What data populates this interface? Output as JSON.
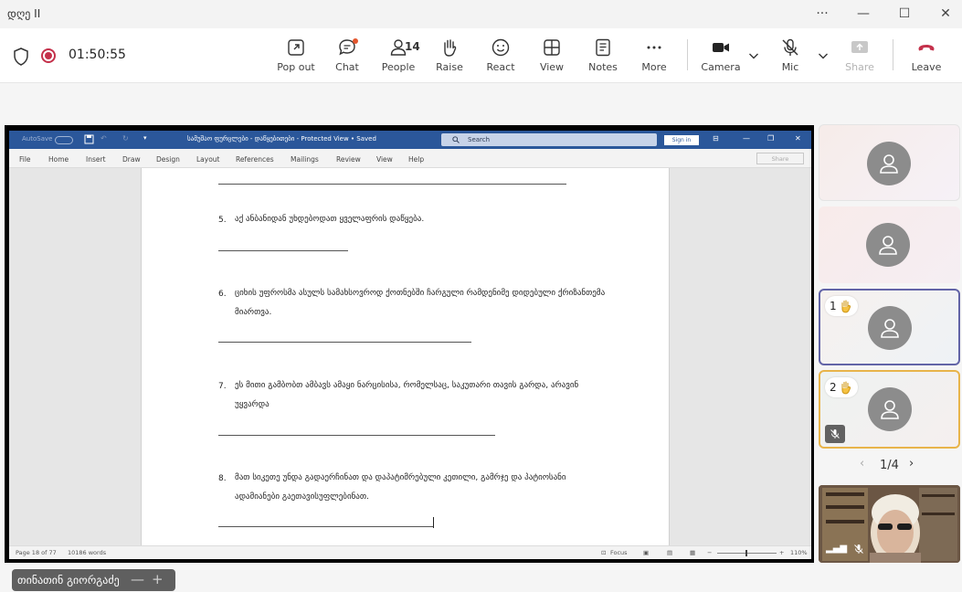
{
  "window": {
    "title": "დღე II",
    "controls": {
      "more": "···",
      "minimize": "—",
      "maximize": "☐",
      "close": "✕"
    }
  },
  "toolbar": {
    "timer": "01:50:55",
    "people_count": "14",
    "buttons": {
      "popout": "Pop out",
      "chat": "Chat",
      "people": "People",
      "raise": "Raise",
      "react": "React",
      "view": "View",
      "notes": "Notes",
      "more": "More",
      "camera": "Camera",
      "mic": "Mic",
      "share": "Share",
      "leave": "Leave"
    },
    "colors": {
      "leave": "#c4314b",
      "recording": "#c4314b",
      "chat_dot": "#e3562d"
    }
  },
  "word": {
    "autosave": "AutoSave",
    "doc_title": "სამუშაო ფურცლები - დაწყებითები  -  Protected View • Saved",
    "search_placeholder": "Search",
    "signin": "Sign in",
    "menu": [
      "File",
      "Home",
      "Insert",
      "Draw",
      "Design",
      "Layout",
      "References",
      "Mailings",
      "Review",
      "View",
      "Help"
    ],
    "share": "Share",
    "questions": [
      {
        "num": "5.",
        "text": "აქ ანბანიდან უხდებოდათ ყველაფრის დაწყება."
      },
      {
        "num": "6.",
        "text": "ციხის უფროსმა ასულს სამახსოვროდ ქოთნებში ჩარგული რამდენიმე დიდებული ქრიზანთემა მიართვა."
      },
      {
        "num": "7.",
        "text": "ეს მითი გამბობთ ამბავს ამაყი ნარცისისა, რომელსაც, საკუთარი თავის გარდა, არავინ უყვარდა"
      },
      {
        "num": "8.",
        "text": "მათ სიკეთე უნდა გადაერჩინათ და დაპატიმრებული კეთილი, გამრჯე და პატიოსანი ადამიანები გაეთავისუფლებინათ."
      }
    ],
    "status": {
      "page": "Page 18 of 77",
      "words": "10186 words",
      "focus": "Focus",
      "zoom": "110%"
    }
  },
  "participants": {
    "tiles": [
      {
        "hand": false,
        "muted": false
      },
      {
        "hand": false,
        "muted": false
      },
      {
        "hand": true,
        "hand_order": "1",
        "muted": false
      },
      {
        "hand": true,
        "hand_order": "2",
        "muted": true
      }
    ],
    "pager": "1/4"
  },
  "presenter": {
    "name": "თინათინ გიორგაძე",
    "minimize": "—",
    "expand": "+"
  }
}
